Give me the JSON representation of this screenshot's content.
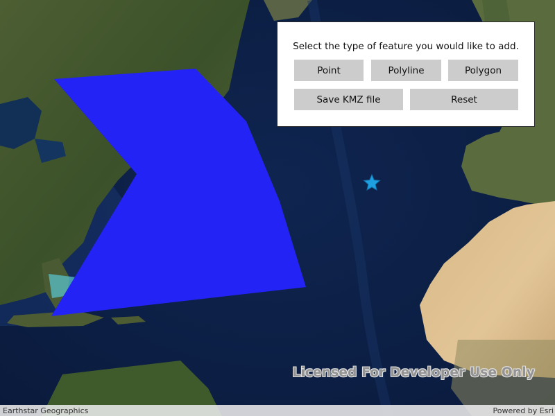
{
  "panel": {
    "prompt": "Select the type of feature you would like to add.",
    "buttons": {
      "point": "Point",
      "polyline": "Polyline",
      "polygon": "Polygon",
      "save": "Save KMZ file",
      "reset": "Reset"
    }
  },
  "map": {
    "basemap": "satellite imagery",
    "polygon_color": "#2323f5",
    "point_symbol": "star-icon",
    "point_color": "#1ea0e0",
    "watermark": "Licensed For Developer Use Only"
  },
  "attribution": {
    "left": "Earthstar Geographics",
    "right": "Powered by Esri"
  }
}
